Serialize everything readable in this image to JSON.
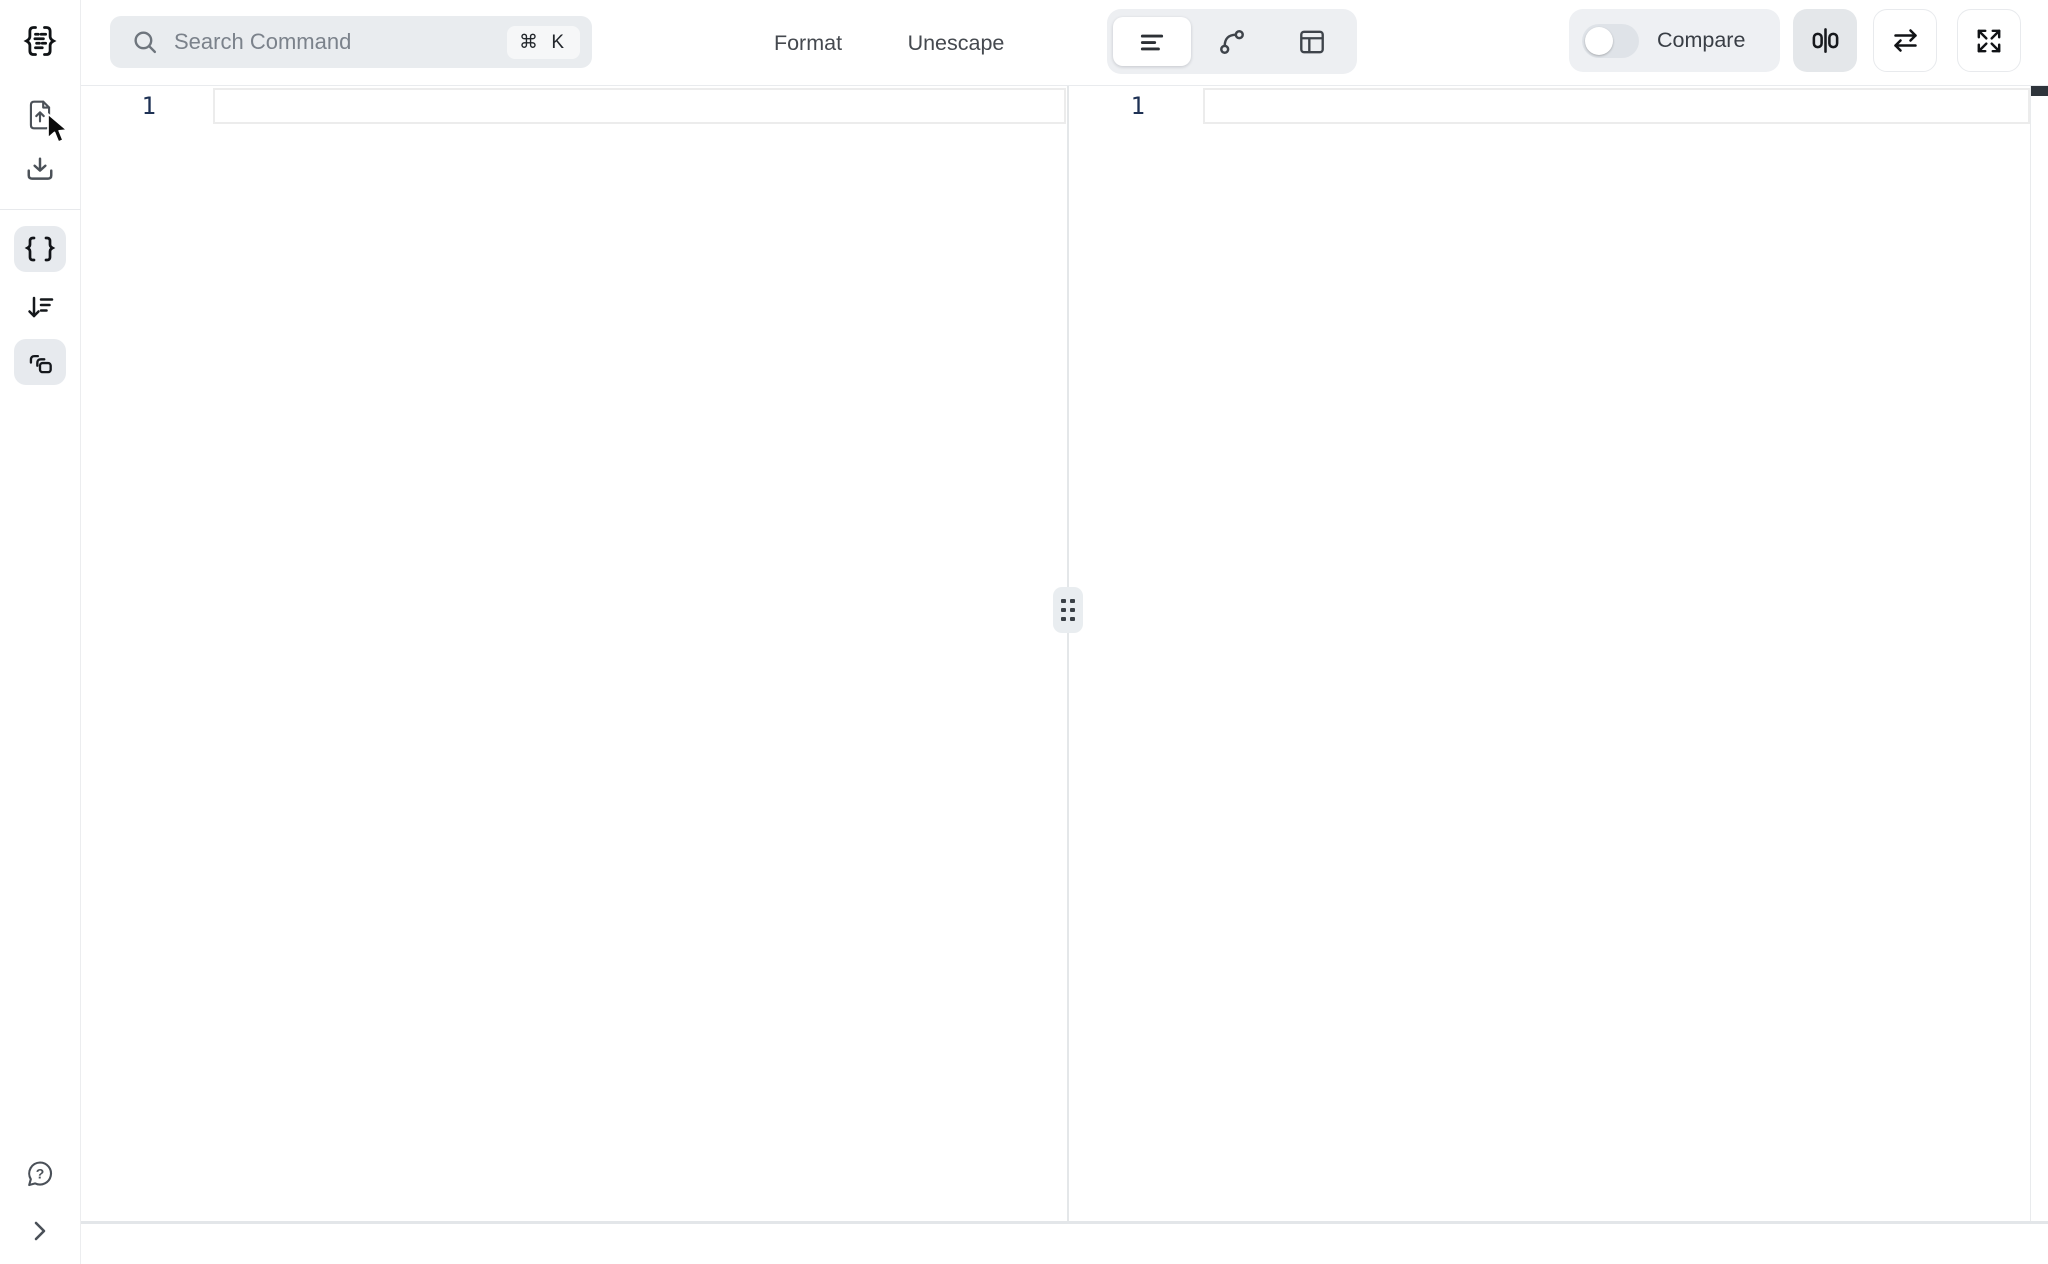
{
  "toolbar": {
    "search": {
      "placeholder": "Search Command",
      "shortcut": "⌘ K",
      "icon": "search-icon"
    },
    "actions": [
      {
        "label": "Format"
      },
      {
        "label": "Unescape"
      }
    ]
  },
  "view_switcher": {
    "options": [
      {
        "name": "text-view",
        "icon": "text-lines-icon",
        "active": true
      },
      {
        "name": "graph-view",
        "icon": "graph-spline-icon",
        "active": false
      },
      {
        "name": "table-view",
        "icon": "table-icon",
        "active": false
      }
    ]
  },
  "compare": {
    "label": "Compare",
    "enabled": false
  },
  "right_buttons": [
    {
      "name": "split-columns",
      "icon": "split-columns-icon",
      "pressed": true
    },
    {
      "name": "swap-panes",
      "icon": "swap-arrows-icon",
      "pressed": false
    },
    {
      "name": "fullscreen",
      "icon": "fullscreen-icon",
      "pressed": false
    }
  ],
  "sidebar": {
    "top_items": [
      {
        "name": "logo",
        "icon": "braces-document-logo"
      },
      {
        "name": "upload-file",
        "icon": "file-upload-icon"
      },
      {
        "name": "download-file",
        "icon": "file-download-icon"
      }
    ],
    "tool_items": [
      {
        "name": "json-editor",
        "icon": "curly-braces-icon",
        "active": true
      },
      {
        "name": "sort",
        "icon": "sort-lines-icon",
        "active": false
      },
      {
        "name": "compare-documents",
        "icon": "overlapping-panels-icon",
        "active": true
      }
    ],
    "bottom_items": [
      {
        "name": "help",
        "icon": "help-bubble-icon"
      },
      {
        "name": "expand-sidebar",
        "icon": "chevron-right-icon"
      }
    ]
  },
  "editor_left": {
    "line_numbers": [
      "1"
    ],
    "content": ""
  },
  "editor_right": {
    "line_numbers": [
      "1"
    ],
    "content": ""
  },
  "colors": {
    "chip_bg": "#e9ecef",
    "border": "#e7e9ec",
    "line_number": "#1e3154",
    "active_segment": "#ffffff",
    "scroll_marker": "#2e343b",
    "toggle_track": "#dfe3e8"
  }
}
